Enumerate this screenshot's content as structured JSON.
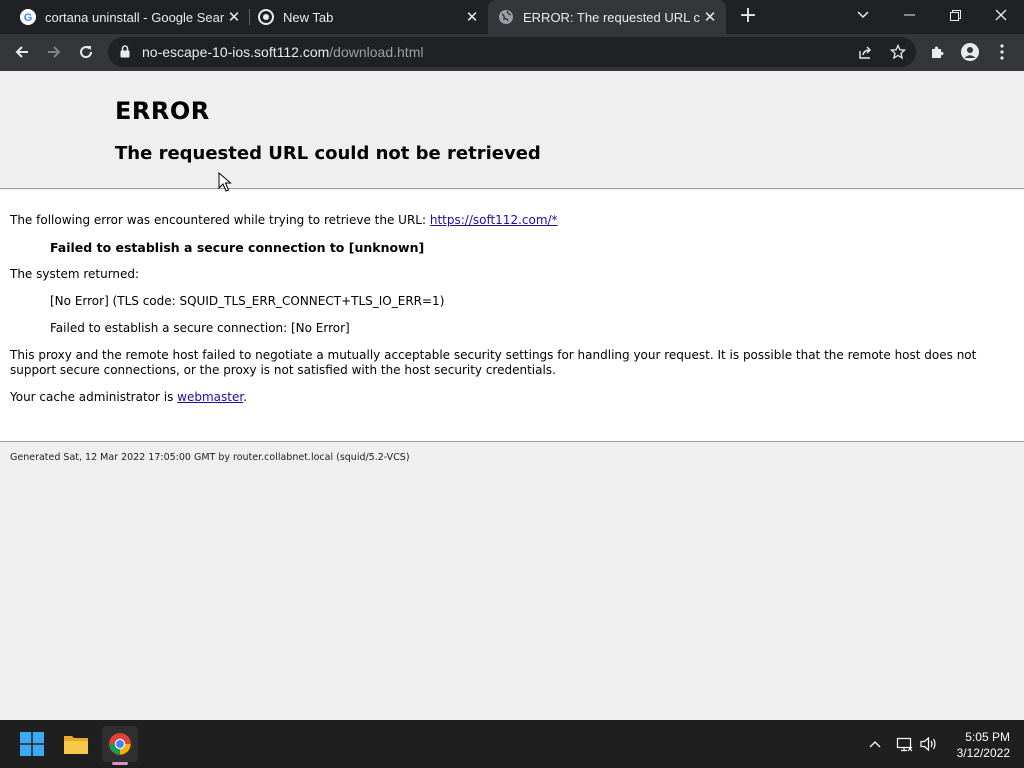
{
  "browser": {
    "tabs": [
      {
        "title": "cortana uninstall - Google Search",
        "favicon": "google-icon"
      },
      {
        "title": "New Tab",
        "favicon": "chrome-icon"
      },
      {
        "title": "ERROR: The requested URL could",
        "favicon": "globe-icon",
        "active": true
      }
    ],
    "address": {
      "host": "no-escape-10-ios.soft112.com",
      "path": "/download.html"
    }
  },
  "page": {
    "title": "ERROR",
    "subtitle": "The requested URL could not be retrieved",
    "intro": "The following error was encountered while trying to retrieve the URL: ",
    "url_link": "https://soft112.com/*",
    "failure": "Failed to establish a secure connection to [unknown]",
    "system_returned": "The system returned:",
    "tls_code": "[No Error] (TLS code: SQUID_TLS_ERR_CONNECT+TLS_IO_ERR=1)",
    "secure_failure": "Failed to establish a secure connection: [No Error]",
    "explanation": "This proxy and the remote host failed to negotiate a mutually acceptable security settings for handling your request. It is possible that the remote host does not support secure connections, or the proxy is not satisfied with the host security credentials.",
    "admin_prefix": "Your cache administrator is ",
    "admin_link": "webmaster",
    "admin_suffix": ".",
    "footer": "Generated Sat, 12 Mar 2022 17:05:00 GMT by router.collabnet.local (squid/5.2-VCS)"
  },
  "taskbar": {
    "time": "5:05 PM",
    "date": "3/12/2022"
  },
  "colors": {
    "titlebar": "#202124",
    "toolbar": "#35363a",
    "link": "#1a0dab",
    "taskbar": "#1f1f1f"
  }
}
